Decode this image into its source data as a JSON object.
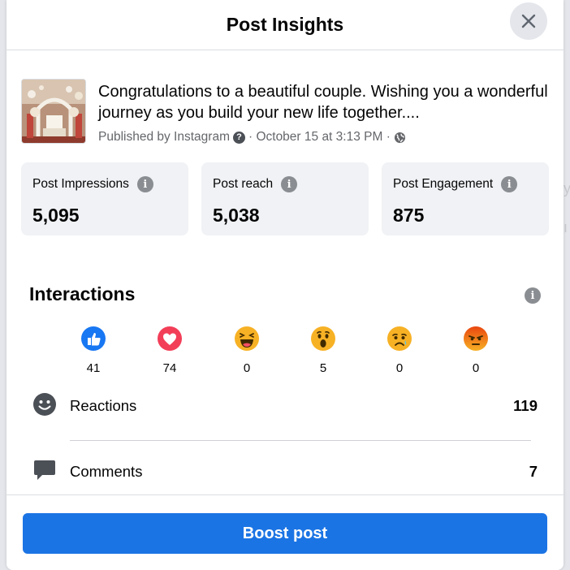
{
  "header": {
    "title": "Post Insights"
  },
  "post": {
    "text": "Congratulations to a beautiful couple. Wishing you a wonderful journey as you build your new life together....",
    "published_by": "Published by Instagram",
    "date": "· October 15 at 3:13 PM ·"
  },
  "stats": [
    {
      "label": "Post Impressions",
      "value": "5,095"
    },
    {
      "label": "Post reach",
      "value": "5,038"
    },
    {
      "label": "Post Engagement",
      "value": "875"
    }
  ],
  "interactions": {
    "title": "Interactions",
    "reactions": [
      {
        "icon": "like-icon",
        "count": "41",
        "color": "#1877f2"
      },
      {
        "icon": "love-icon",
        "count": "74",
        "color": "#f33e58"
      },
      {
        "icon": "haha-icon",
        "count": "0",
        "color": "#f7b125"
      },
      {
        "icon": "wow-icon",
        "count": "5",
        "color": "#f7b125"
      },
      {
        "icon": "sad-icon",
        "count": "0",
        "color": "#f7b125"
      },
      {
        "icon": "angry-icon",
        "count": "0",
        "color": "#e9710f"
      }
    ],
    "metrics": [
      {
        "icon": "smiley-icon",
        "label": "Reactions",
        "value": "119"
      },
      {
        "icon": "comment-icon",
        "label": "Comments",
        "value": "7"
      }
    ]
  },
  "footer": {
    "boost_label": "Boost post"
  },
  "colors": {
    "accent": "#1b74e4",
    "card_bg": "#f0f2f5",
    "secondary_text": "#65676b"
  }
}
